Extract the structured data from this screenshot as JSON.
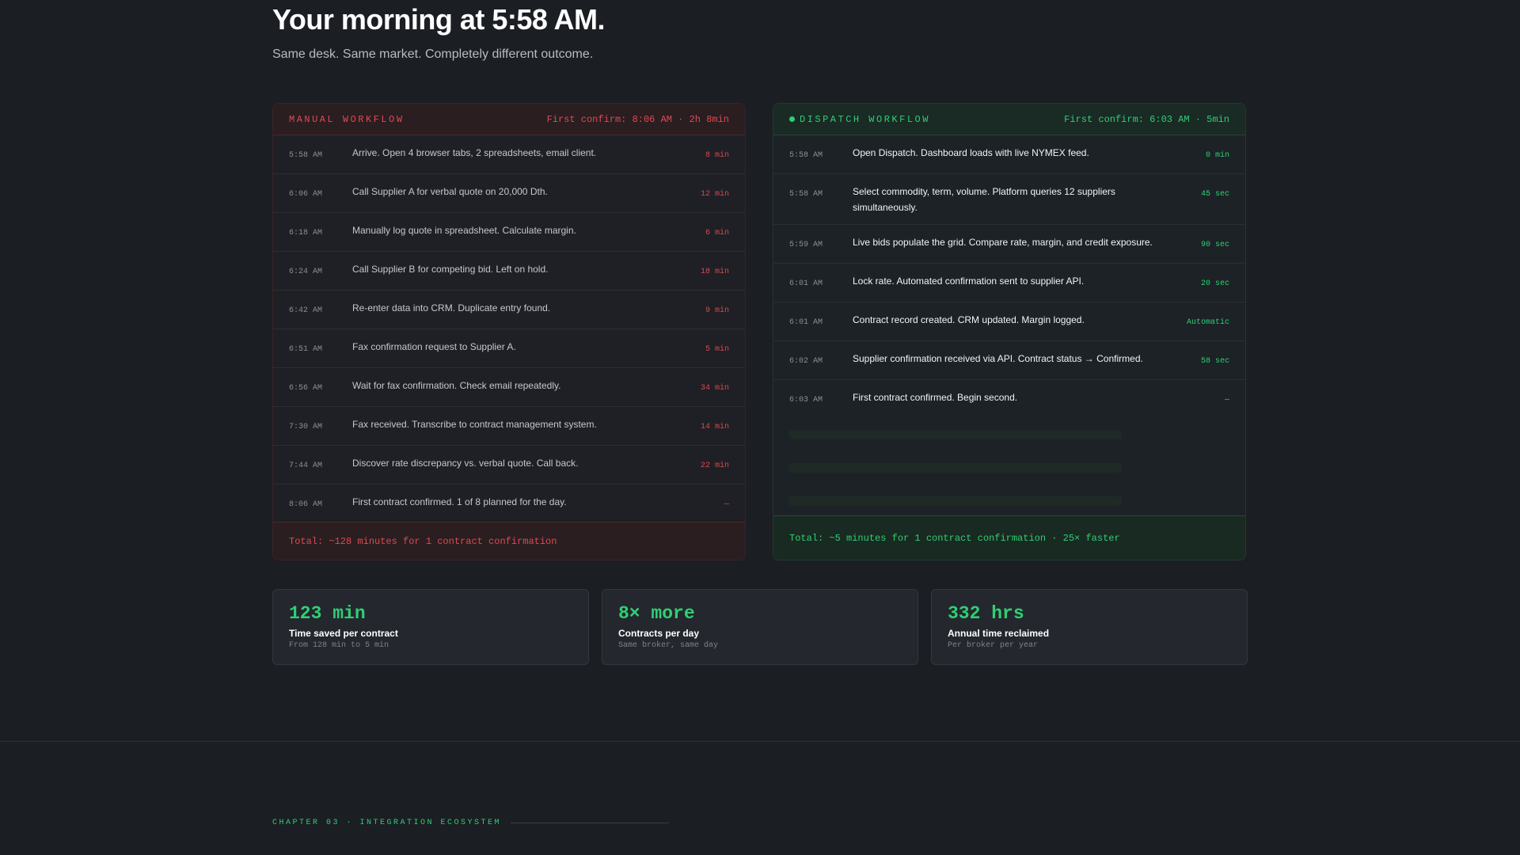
{
  "hero": {
    "title": "Your morning at 5:58 AM.",
    "subtitle": "Same desk. Same market. Completely different outcome."
  },
  "manual": {
    "title": "MANUAL WORKFLOW",
    "meta": "First confirm: 8:06 AM · 2h 8min",
    "rows": [
      {
        "time": "5:58 AM",
        "desc": "Arrive. Open 4 browser tabs, 2 spreadsheets, email client.",
        "dur": "8 min"
      },
      {
        "time": "6:06 AM",
        "desc": "Call Supplier A for verbal quote on 20,000 Dth.",
        "dur": "12 min"
      },
      {
        "time": "6:18 AM",
        "desc": "Manually log quote in spreadsheet. Calculate margin.",
        "dur": "6 min"
      },
      {
        "time": "6:24 AM",
        "desc": "Call Supplier B for competing bid. Left on hold.",
        "dur": "18 min"
      },
      {
        "time": "6:42 AM",
        "desc": "Re-enter data into CRM. Duplicate entry found.",
        "dur": "9 min"
      },
      {
        "time": "6:51 AM",
        "desc": "Fax confirmation request to Supplier A.",
        "dur": "5 min"
      },
      {
        "time": "6:56 AM",
        "desc": "Wait for fax confirmation. Check email repeatedly.",
        "dur": "34 min"
      },
      {
        "time": "7:30 AM",
        "desc": "Fax received. Transcribe to contract management system.",
        "dur": "14 min"
      },
      {
        "time": "7:44 AM",
        "desc": "Discover rate discrepancy vs. verbal quote. Call back.",
        "dur": "22 min"
      },
      {
        "time": "8:06 AM",
        "desc": "First contract confirmed. 1 of 8 planned for the day.",
        "dur": "—"
      }
    ],
    "total": "Total: ~128 minutes for 1 contract confirmation"
  },
  "dispatch": {
    "title": "DISPATCH WORKFLOW",
    "meta": "First confirm: 6:03 AM · 5min",
    "rows": [
      {
        "time": "5:58 AM",
        "desc": "Open Dispatch. Dashboard loads with live NYMEX feed.",
        "dur": "0 min"
      },
      {
        "time": "5:58 AM",
        "desc": "Select commodity, term, volume. Platform queries 12 suppliers simultaneously.",
        "dur": "45 sec"
      },
      {
        "time": "5:59 AM",
        "desc": "Live bids populate the grid. Compare rate, margin, and credit exposure.",
        "dur": "90 sec"
      },
      {
        "time": "6:01 AM",
        "desc": "Lock rate. Automated confirmation sent to supplier API.",
        "dur": "20 sec"
      },
      {
        "time": "6:01 AM",
        "desc": "Contract record created. CRM updated. Margin logged.",
        "dur": "Automatic"
      },
      {
        "time": "6:02 AM",
        "desc": "Supplier confirmation received via API. Contract status → Confirmed.",
        "dur": "58 sec"
      },
      {
        "time": "6:03 AM",
        "desc": "First contract confirmed. Begin second.",
        "dur": "—"
      }
    ],
    "total": "Total: ~5 minutes for 1 contract confirmation · 25× faster"
  },
  "stats": [
    {
      "value": "123 min",
      "label": "Time saved per contract",
      "sub": "From 128 min to 5 min"
    },
    {
      "value": "8× more",
      "label": "Contracts per day",
      "sub": "Same broker, same day"
    },
    {
      "value": "332 hrs",
      "label": "Annual time reclaimed",
      "sub": "Per broker per year"
    }
  ],
  "chapter": {
    "label": "CHAPTER 03 · INTEGRATION ECOSYSTEM"
  }
}
